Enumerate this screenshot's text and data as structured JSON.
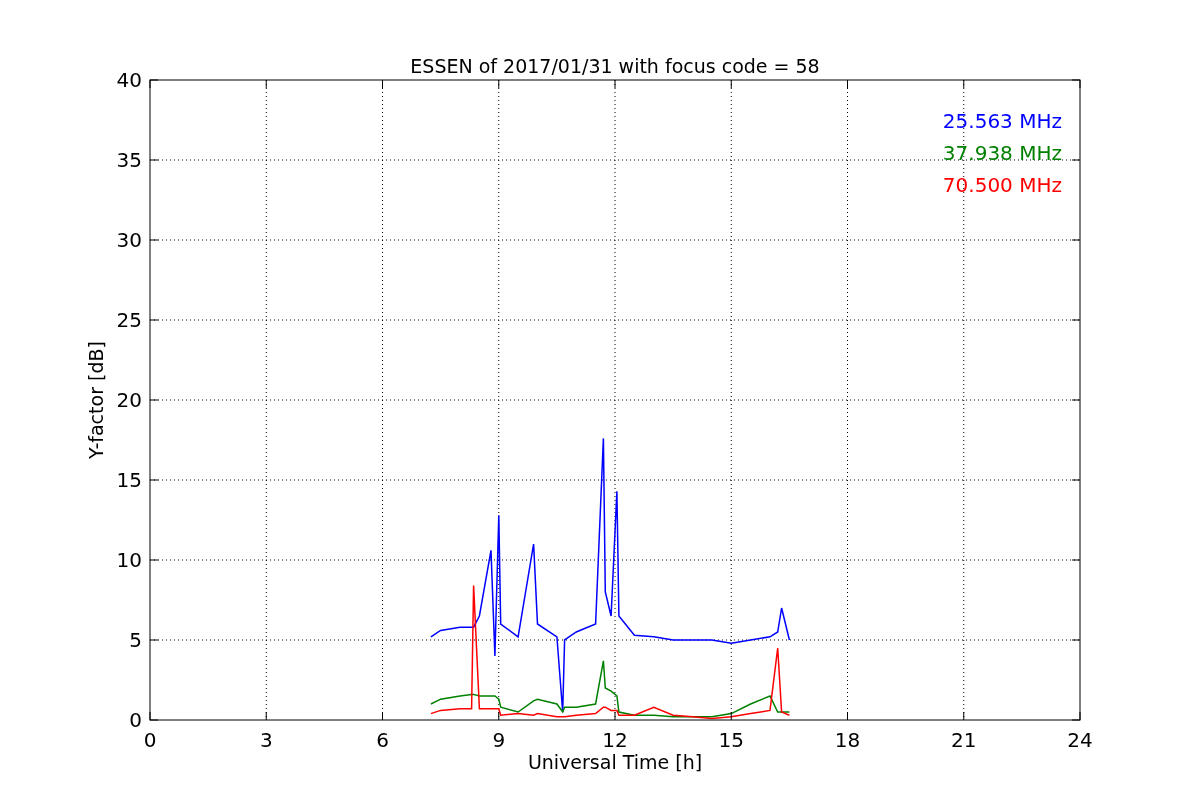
{
  "chart_data": {
    "type": "line",
    "title": "ESSEN of 2017/01/31 with focus code = 58",
    "xlabel": "Universal Time [h]",
    "ylabel": "Y-factor [dB]",
    "x": [
      7.25,
      7.5,
      8,
      8.3,
      8.35,
      8.5,
      8.8,
      8.9,
      9.0,
      9.05,
      9.5,
      9.9,
      10,
      10.5,
      10.65,
      10.7,
      11,
      11.5,
      11.7,
      11.75,
      11.9,
      12.05,
      12.1,
      12.5,
      13,
      13.5,
      14,
      14.5,
      15,
      15.5,
      16,
      16.2,
      16.3,
      16.5
    ],
    "series": [
      {
        "name": "25.563 MHz",
        "color": "#0000ff",
        "values": [
          5.2,
          5.6,
          5.8,
          5.8,
          5.8,
          6.5,
          10.6,
          4,
          12.8,
          6,
          5.2,
          11,
          6,
          5.2,
          0.5,
          5,
          5.5,
          6,
          17.6,
          8,
          6.5,
          14.3,
          6.5,
          5.3,
          5.2,
          5,
          5,
          5,
          4.8,
          5,
          5.2,
          5.5,
          7,
          5
        ]
      },
      {
        "name": "37.938 MHz",
        "color": "#008000",
        "values": [
          1,
          1.3,
          1.5,
          1.6,
          1.6,
          1.5,
          1.5,
          1.5,
          1.3,
          0.8,
          0.5,
          1.2,
          1.3,
          1,
          0.5,
          0.8,
          0.8,
          1,
          3.7,
          2,
          1.8,
          1.5,
          0.5,
          0.3,
          0.3,
          0.2,
          0.2,
          0.2,
          0.4,
          1,
          1.5,
          0.5,
          0.5,
          0.5
        ]
      },
      {
        "name": "70.500 MHz",
        "color": "#ff0000",
        "values": [
          0.4,
          0.6,
          0.7,
          0.7,
          8.4,
          0.7,
          0.7,
          0.7,
          0.7,
          0.3,
          0.4,
          0.3,
          0.4,
          0.2,
          0.2,
          0.2,
          0.3,
          0.4,
          0.8,
          0.8,
          0.6,
          0.6,
          0.3,
          0.3,
          0.8,
          0.3,
          0.2,
          0.1,
          0.2,
          0.4,
          0.6,
          4.5,
          0.5,
          0.3
        ]
      }
    ],
    "xlim": [
      0,
      24
    ],
    "ylim": [
      0,
      40
    ],
    "xticks": [
      0,
      3,
      6,
      9,
      12,
      15,
      18,
      21,
      24
    ],
    "yticks": [
      0,
      5,
      10,
      15,
      20,
      25,
      30,
      35,
      40
    ],
    "grid": true
  }
}
